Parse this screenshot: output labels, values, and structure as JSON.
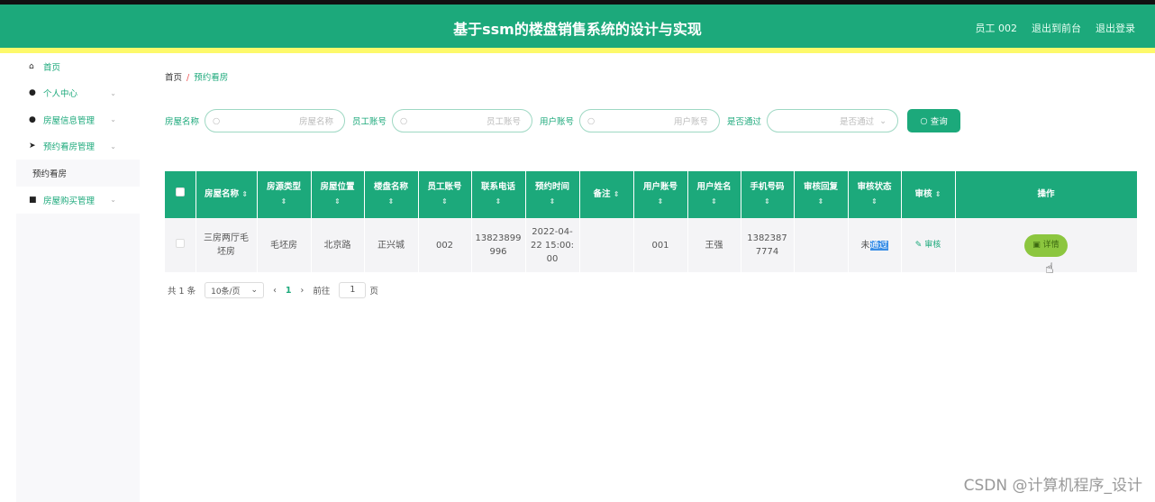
{
  "header": {
    "title": "基于ssm的楼盘销售系统的设计与实现",
    "user": "员工 002",
    "to_front": "退出到前台",
    "logout": "退出登录"
  },
  "sidebar": {
    "items": [
      {
        "label": "首页",
        "icon": "home-icon"
      },
      {
        "label": "个人中心",
        "icon": "user-icon"
      },
      {
        "label": "房屋信息管理",
        "icon": "location-icon"
      },
      {
        "label": "预约看房管理",
        "icon": "send-icon"
      }
    ],
    "sub": "预约看房",
    "last": {
      "label": "房屋购买管理",
      "icon": "grid-icon"
    }
  },
  "breadcrumb": {
    "home": "首页",
    "sep": "/",
    "current": "预约看房"
  },
  "search": {
    "f1_label": "房屋名称",
    "f1_ph": "房屋名称",
    "f2_label": "员工账号",
    "f2_ph": "员工账号",
    "f3_label": "用户账号",
    "f3_ph": "用户账号",
    "f4_label": "是否通过",
    "f4_ph": "是否通过",
    "button": "查询"
  },
  "table": {
    "headers": [
      "房屋名称",
      "房源类型",
      "房屋位置",
      "楼盘名称",
      "员工账号",
      "联系电话",
      "预约时间",
      "备注",
      "用户账号",
      "用户姓名",
      "手机号码",
      "审核回复",
      "审核状态",
      "审核",
      "操作"
    ],
    "rows": [
      {
        "name": "三房两厅毛坯房",
        "type": "毛坯房",
        "loc": "北京路",
        "estate": "正兴城",
        "staff": "002",
        "phone": "13823899996",
        "time": "2022-04-22 15:00:00",
        "note": "",
        "user": "001",
        "uname": "王强",
        "mobile": "13823877774",
        "reply": "",
        "status_a": "未",
        "status_b": "通过",
        "audit": "审核",
        "detail": "详情"
      }
    ]
  },
  "pager": {
    "total": "共 1 条",
    "size": "10条/页",
    "page": "1",
    "goto": "前往",
    "goto_val": "1",
    "unit": "页"
  },
  "watermark": "CSDN @计算机程序_设计"
}
